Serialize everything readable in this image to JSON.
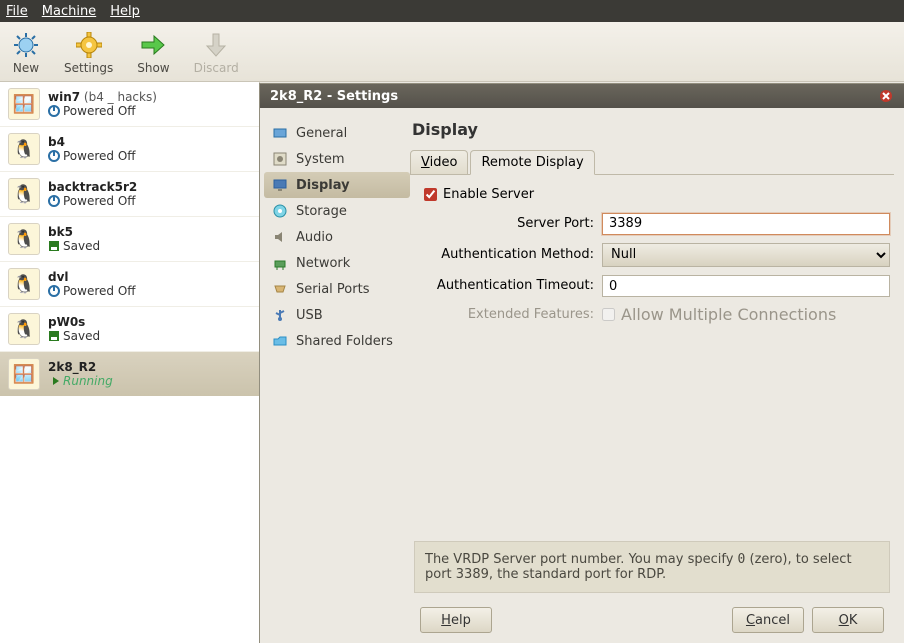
{
  "menubar": {
    "file": "File",
    "machine": "Machine",
    "help": "Help"
  },
  "toolbar": {
    "new": "New",
    "settings": "Settings",
    "show": "Show",
    "discard": "Discard"
  },
  "vms": [
    {
      "name": "win7",
      "extra": "(b4 _ hacks)",
      "state": "Powered Off",
      "state_kind": "off",
      "os": "win7"
    },
    {
      "name": "b4",
      "extra": "",
      "state": "Powered Off",
      "state_kind": "off",
      "os": "linux"
    },
    {
      "name": "backtrack5r2",
      "extra": "",
      "state": "Powered Off",
      "state_kind": "off",
      "os": "linux"
    },
    {
      "name": "bk5",
      "extra": "",
      "state": "Saved",
      "state_kind": "saved",
      "os": "linux"
    },
    {
      "name": "dvl",
      "extra": "",
      "state": "Powered Off",
      "state_kind": "off",
      "os": "linux"
    },
    {
      "name": "pW0s",
      "extra": "",
      "state": "Saved",
      "state_kind": "saved",
      "os": "linux"
    },
    {
      "name": "2k8_R2",
      "extra": "",
      "state": "Running",
      "state_kind": "running",
      "os": "win2008"
    }
  ],
  "vm_selected_index": 6,
  "settings": {
    "window_title": "2k8_R2 - Settings",
    "categories": [
      {
        "id": "general",
        "label": "General",
        "icon": "general"
      },
      {
        "id": "system",
        "label": "System",
        "icon": "system"
      },
      {
        "id": "display",
        "label": "Display",
        "icon": "display"
      },
      {
        "id": "storage",
        "label": "Storage",
        "icon": "storage"
      },
      {
        "id": "audio",
        "label": "Audio",
        "icon": "audio"
      },
      {
        "id": "network",
        "label": "Network",
        "icon": "network"
      },
      {
        "id": "serial",
        "label": "Serial Ports",
        "icon": "serial"
      },
      {
        "id": "usb",
        "label": "USB",
        "icon": "usb"
      },
      {
        "id": "shared",
        "label": "Shared Folders",
        "icon": "shared"
      }
    ],
    "selected_category_id": "display",
    "page_title": "Display",
    "tabs": [
      {
        "id": "video",
        "label": "Video"
      },
      {
        "id": "remote",
        "label": "Remote Display"
      }
    ],
    "active_tab_id": "remote",
    "remote_display": {
      "enable_label": "Enable Server",
      "enabled": true,
      "server_port_label": "Server Port:",
      "server_port_value": "3389",
      "auth_method_label": "Authentication Method:",
      "auth_method_value": "Null",
      "auth_timeout_label": "Authentication Timeout:",
      "auth_timeout_value": "0",
      "ext_features_label": "Extended Features:",
      "allow_multi_label": "Allow Multiple Connections",
      "allow_multi_checked": false
    },
    "hint_prefix": "The VRDP Server port number. You may specify ",
    "hint_zero": "0",
    "hint_suffix": " (zero), to select port 3389, the standard port for RDP.",
    "help_label": "Help",
    "cancel_label": "Cancel",
    "ok_label": "OK"
  }
}
